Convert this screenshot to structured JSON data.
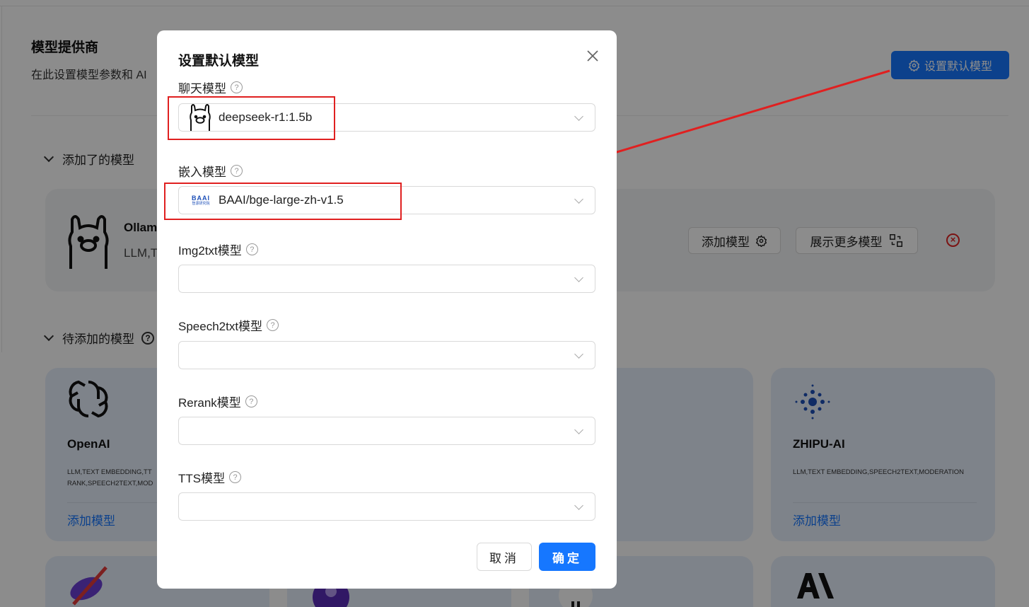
{
  "page": {
    "title": "模型提供商",
    "description": "在此设置模型参数和 AI",
    "set_default_button": "设置默认模型",
    "added_section": "添加了的模型",
    "pending_section": "待添加的模型",
    "added_provider": {
      "name": "Ollam",
      "tags": "LLM,T",
      "add_model_button": "添加模型",
      "show_more_button": "展示更多模型"
    },
    "providers": [
      {
        "name": "OpenAI",
        "tags_line1": "LLM,TEXT EMBEDDING,TT",
        "tags_line2": "RANK,SPEECH2TEXT,MOD",
        "add_link": "添加模型"
      },
      {
        "name": "ZHIPU-AI",
        "tags_line1": "LLM,TEXT EMBEDDING,SPEECH2TEXT,MODERATION",
        "tags_line2": "",
        "add_link": "添加模型"
      }
    ]
  },
  "modal": {
    "title": "设置默认模型",
    "fields": [
      {
        "label": "聊天模型",
        "value": "deepseek-r1:1.5b",
        "icon": "ollama-llama-icon"
      },
      {
        "label": "嵌入模型",
        "value": "BAAI/bge-large-zh-v1.5",
        "icon": "baai-logo-icon",
        "logo_text": "BAAI",
        "logo_subtext": "智源研究院"
      },
      {
        "label": "Img2txt模型",
        "value": ""
      },
      {
        "label": "Speech2txt模型",
        "value": ""
      },
      {
        "label": "Rerank模型",
        "value": ""
      },
      {
        "label": "TTS模型",
        "value": ""
      }
    ],
    "cancel_button": "取消",
    "ok_button": "确定"
  },
  "colors": {
    "primary": "#1677ff",
    "annotation_red": "#e02020",
    "card_bg": "#e6eefb",
    "mask": "rgba(0,0,0,0.45)"
  }
}
